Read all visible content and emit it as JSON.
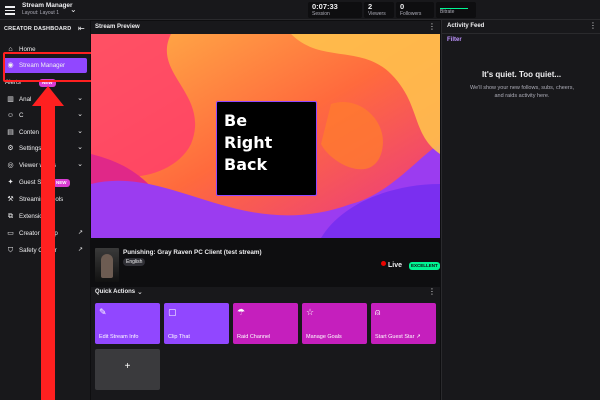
{
  "topbar": {
    "app_title": "Stream Manager",
    "layout_label": "Layout: Layout 1",
    "stats": [
      {
        "value": "0:07:33",
        "label": "Session"
      },
      {
        "value": "2",
        "label": "Viewers"
      },
      {
        "value": "0",
        "label": "Followers"
      },
      {
        "value": "",
        "label": "Bitrate"
      }
    ]
  },
  "sidebar": {
    "heading": "CREATOR DASHBOARD",
    "items": [
      {
        "label": "Home",
        "icon": "home-icon"
      },
      {
        "label": "Stream Manager",
        "icon": "broadcast-icon"
      },
      {
        "label": "Alerts",
        "icon": "bell-icon",
        "badge": "NEW"
      },
      {
        "label": "Anal",
        "icon": "chart-icon"
      },
      {
        "label": "C",
        "icon": "community-icon"
      },
      {
        "label": "Conten",
        "icon": "content-icon"
      },
      {
        "label": "Settings",
        "icon": "gear-icon"
      },
      {
        "label": "Viewer  wards",
        "icon": "rewards-icon"
      },
      {
        "label": "Guest Star",
        "icon": "guest-star-icon",
        "badge": "NEW"
      },
      {
        "label": "Streaming Tools",
        "icon": "tools-icon"
      },
      {
        "label": "Extensions",
        "icon": "puzzle-icon"
      },
      {
        "label": "Creator Camp",
        "icon": "camp-icon"
      },
      {
        "label": "Safety Center",
        "icon": "shield-icon"
      }
    ]
  },
  "preview": {
    "title": "Stream Preview",
    "overlay_lines": [
      "Be",
      "Right",
      "Back"
    ]
  },
  "stream_info": {
    "game_title": "Punishing: Gray Raven PC Client (test stream)",
    "language": "English",
    "live_label": "Live",
    "health_badge": "EXCELLENT"
  },
  "quick_actions": {
    "title": "Quick Actions",
    "tiles": [
      {
        "label": "Edit Stream Info",
        "color": "#9147ff",
        "icon": "pencil-icon"
      },
      {
        "label": "Clip That",
        "color": "#9147ff",
        "icon": "clip-icon"
      },
      {
        "label": "Raid Channel",
        "color": "#c51fbd",
        "icon": "raid-icon"
      },
      {
        "label": "Manage Goals",
        "color": "#c51fbd",
        "icon": "star-icon"
      },
      {
        "label": "Start Guest Star ↗",
        "color": "#c51fbd",
        "icon": "add-person-icon"
      }
    ],
    "add_label": "+"
  },
  "activity_feed": {
    "title": "Activity Feed",
    "filter_label": "Filter",
    "empty_title": "It's quiet. Too quiet...",
    "empty_text": "We'll show your new follows, subs, cheers, and raids activity here."
  },
  "colors": {
    "accent": "#9147ff",
    "magenta": "#c51fbd",
    "live_red": "#eb0400",
    "health_green": "#00f593",
    "annotation_red": "#ff2020"
  }
}
